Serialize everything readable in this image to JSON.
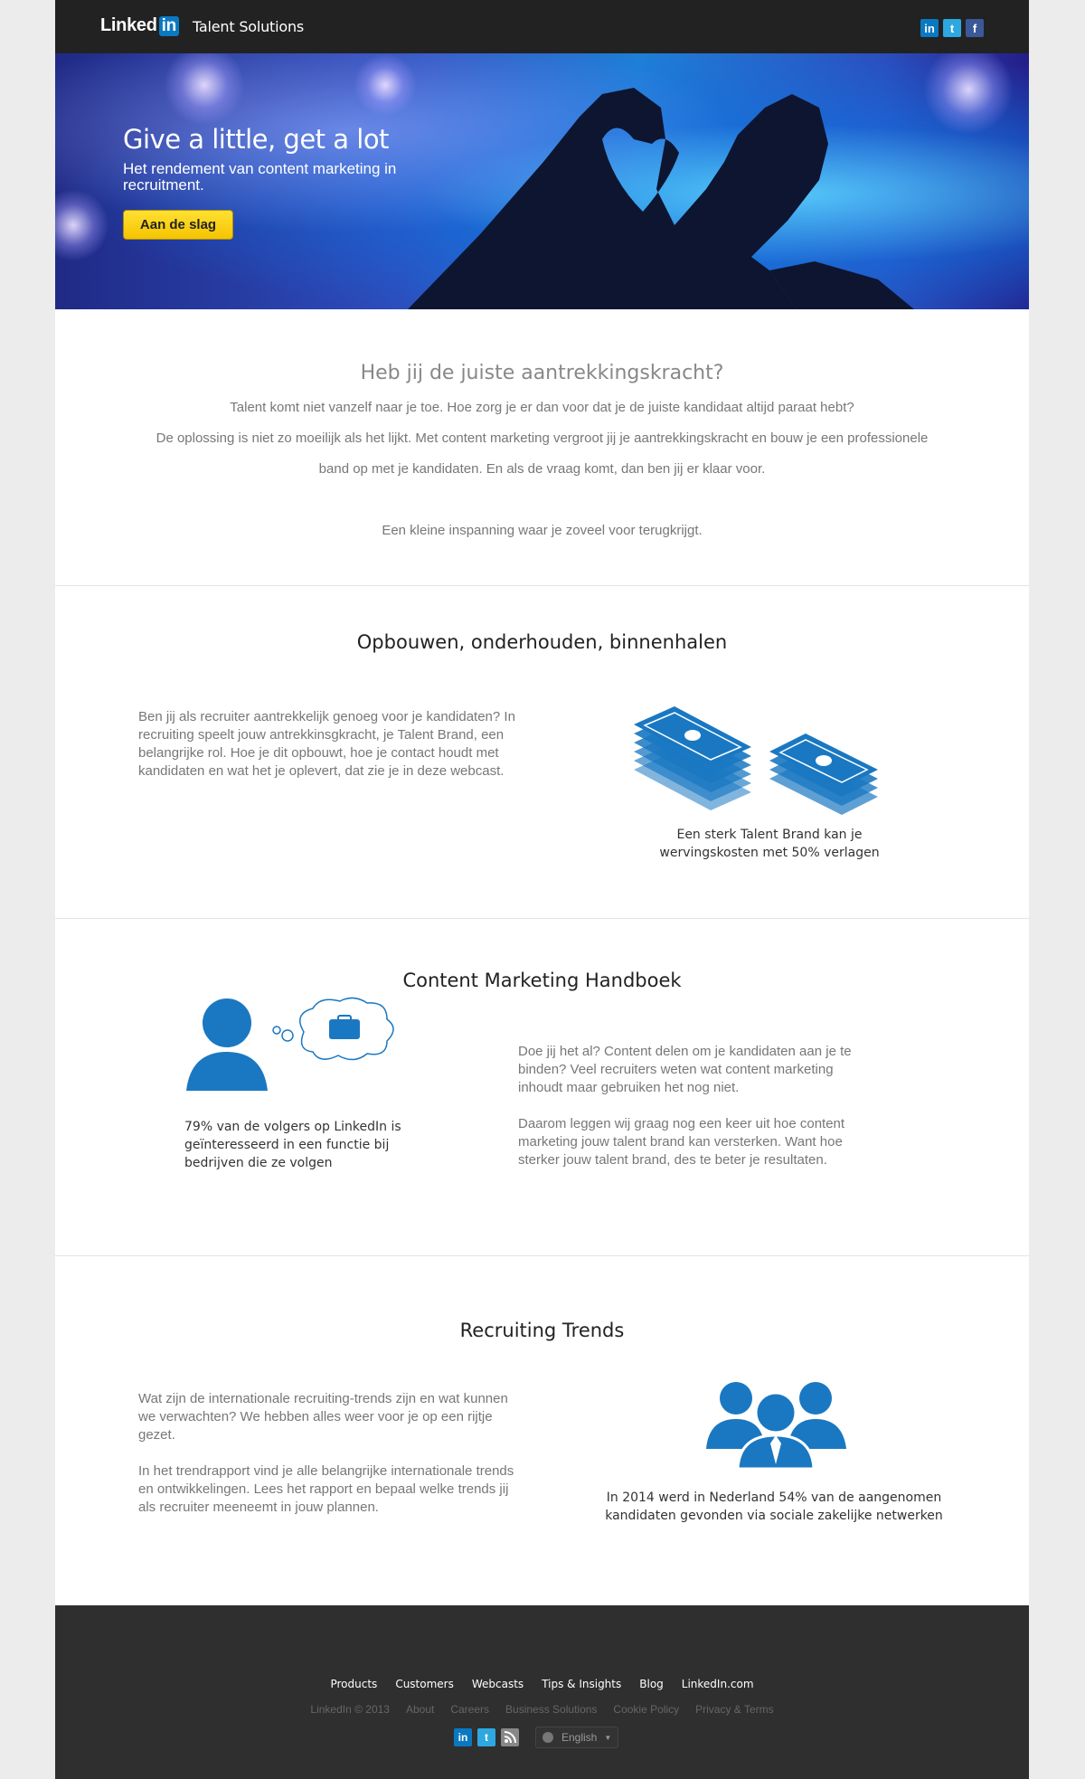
{
  "header": {
    "logo_text": "Linked",
    "logo_badge": "in",
    "product": "Talent Solutions",
    "social": [
      "in",
      "t",
      "f"
    ]
  },
  "hero": {
    "title": "Give a little, get a lot",
    "subtitle": "Het rendement van content marketing in recruitment.",
    "cta": "Aan de slag"
  },
  "intro": {
    "title": "Heb jij de juiste aantrekkingskracht?",
    "p1": "Talent komt niet vanzelf naar je toe. Hoe zorg je er dan voor dat je de juiste kandidaat altijd paraat hebt?",
    "p2": "De oplossing is niet zo moeilijk als het lijkt. Met content marketing vergroot jij je aantrekkingskracht en bouw je een professionele band op met je kandidaten. En als de vraag komt, dan ben jij er klaar voor.",
    "p3": "Een kleine inspanning waar je zoveel voor terugkrijgt."
  },
  "section1": {
    "title": "Opbouwen, onderhouden, binnenhalen",
    "body": "Ben jij als recruiter aantrekkelijk genoeg voor je kandidaten? In recruiting speelt jouw antrekkinsgkracht, je Talent Brand, een belangrijke rol. Hoe je dit opbouwt, hoe je contact houdt met kandidaten en wat het je oplevert, dat zie je in deze webcast.",
    "caption": "Een sterk Talent Brand kan je wervingskosten met 50% verlagen"
  },
  "section2": {
    "title": "Content Marketing Handboek",
    "caption": "79% van de volgers op LinkedIn is geïnteresseerd in een functie bij bedrijven die ze volgen",
    "body1": "Doe jij het al? Content delen om je kandidaten aan je te binden? Veel recruiters weten wat content marketing inhoudt maar gebruiken het nog niet.",
    "body2": "Daarom leggen wij graag nog een keer uit hoe content marketing jouw talent brand kan versterken. Want hoe sterker jouw talent brand, des te beter je resultaten."
  },
  "section3": {
    "title": "Recruiting Trends",
    "body1": "Wat zijn de internationale recruiting-trends zijn en wat kunnen we verwachten? We hebben alles weer voor je op een rijtje gezet.",
    "body2": "In het trendrapport vind je alle belangrijke internationale trends en ontwikkelingen. Lees het rapport en bepaal welke trends jij als recruiter meeneemt in jouw plannen.",
    "caption": "In 2014 werd in Nederland 54% van de aangenomen kandidaten gevonden via sociale zakelijke netwerken"
  },
  "footer": {
    "links": [
      "Products",
      "Customers",
      "Webcasts",
      "Tips & Insights",
      "Blog",
      "LinkedIn.com"
    ],
    "legal": [
      "LinkedIn © 2013",
      "About",
      "Careers",
      "Business Solutions",
      "Cookie Policy",
      "Privacy & Terms"
    ],
    "language": "English"
  },
  "colors": {
    "brand_blue": "#0a79c2",
    "icon_blue": "#1a78c2",
    "cta_yellow": "#f5c400",
    "dark": "#222222"
  }
}
